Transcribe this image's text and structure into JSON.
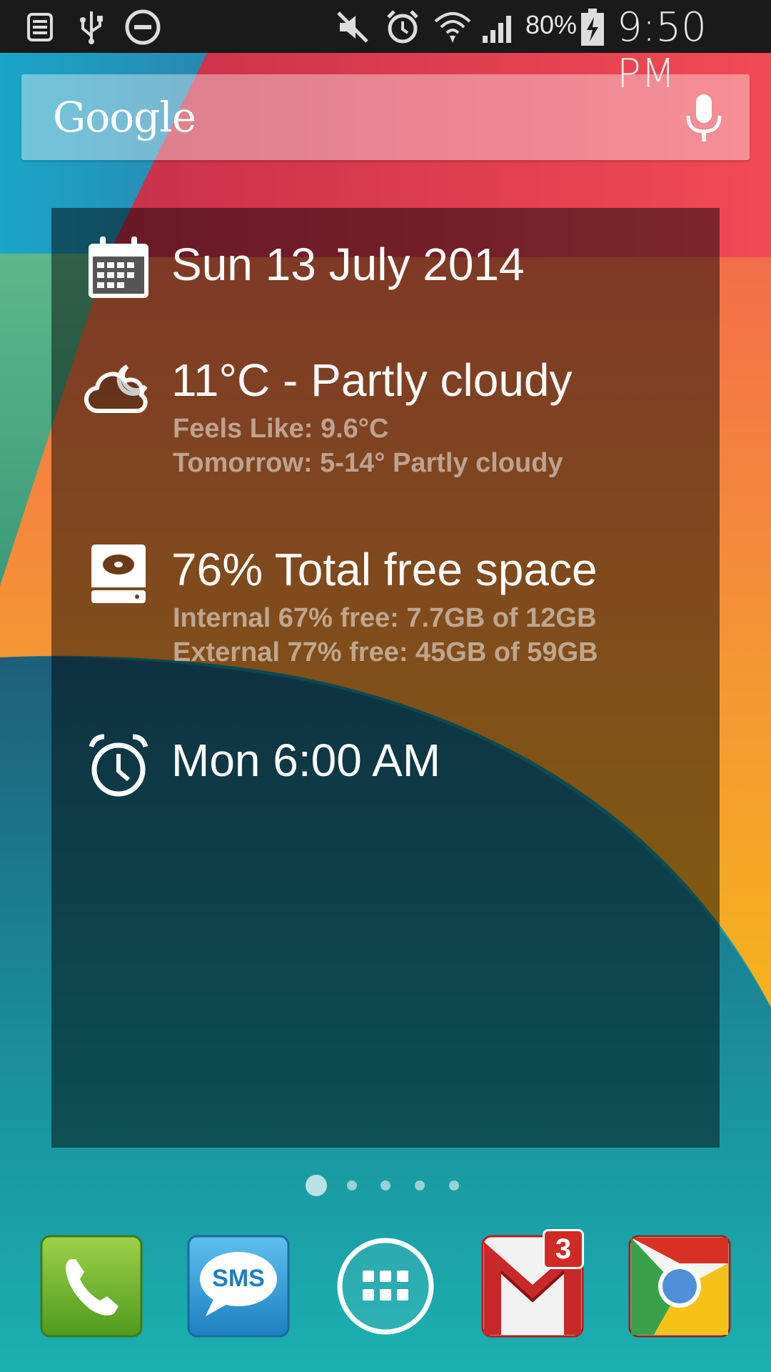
{
  "status_bar": {
    "battery_percent": "80%",
    "time": "9:50 PM",
    "icons": [
      "notification-list-icon",
      "usb-icon",
      "do-not-disturb-icon",
      "mute-icon",
      "alarm-icon",
      "wifi-icon",
      "signal-icon",
      "battery-charging-icon"
    ]
  },
  "search": {
    "logo": "Google",
    "icon": "mic-icon"
  },
  "widget": {
    "date": {
      "icon": "calendar-icon",
      "text": "Sun 13 July 2014"
    },
    "weather": {
      "icon": "partly-cloudy-icon",
      "main": "11°C - Partly cloudy",
      "feels_like": "Feels Like: 9.6°C",
      "tomorrow": "Tomorrow: 5-14° Partly cloudy"
    },
    "storage": {
      "icon": "hard-drive-icon",
      "main": "76% Total free space",
      "internal": "Internal 67% free: 7.7GB of 12GB",
      "external": "External 77% free: 45GB of 59GB"
    },
    "alarm": {
      "icon": "alarm-clock-icon",
      "text": "Mon 6:00 AM"
    }
  },
  "pages": {
    "count": 5,
    "active_index": 0
  },
  "dock": {
    "apps": [
      "Phone",
      "SMS",
      "Apps",
      "Gmail",
      "Chrome"
    ],
    "sms_label": "SMS",
    "gmail_badge": "3"
  },
  "colors": {
    "status_bar": "#1a1a1a",
    "wallpaper_teal": "#1a9ea8",
    "wallpaper_red": "#f0404f",
    "wallpaper_orange": "#f5893a",
    "wallpaper_dark_teal": "#1c6e80"
  }
}
